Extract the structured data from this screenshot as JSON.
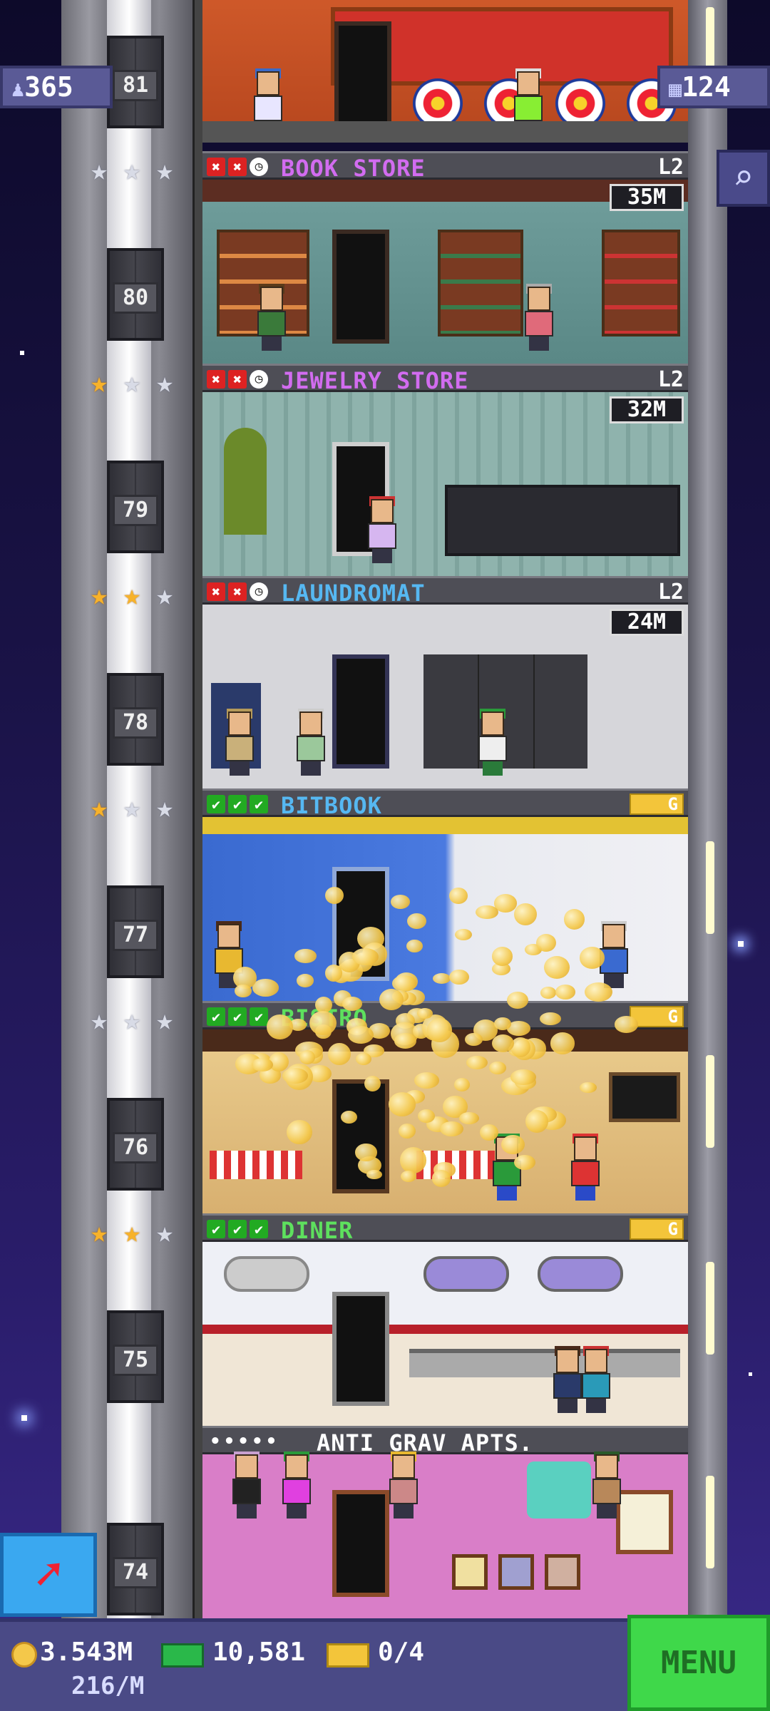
{
  "hud": {
    "population": "365",
    "floors": "124",
    "search_icon": "magnifier-icon"
  },
  "floors": [
    {
      "num": "81",
      "name": "",
      "type": "recreation",
      "level": "",
      "price": "",
      "status": []
    },
    {
      "num": "80",
      "name": "BOOK STORE",
      "color": "#d26cf0",
      "level": "L2",
      "price": "35M",
      "status": [
        "x",
        "x",
        "clock"
      ],
      "stars": 0
    },
    {
      "num": "79",
      "name": "JEWELRY STORE",
      "color": "#d26cf0",
      "level": "L2",
      "price": "32M",
      "status": [
        "x",
        "x",
        "clock"
      ],
      "stars": 1
    },
    {
      "num": "78",
      "name": "LAUNDROMAT",
      "color": "#56b8f2",
      "level": "L2",
      "price": "24M",
      "status": [
        "x",
        "x",
        "clock"
      ],
      "stars": 2
    },
    {
      "num": "77",
      "name": "BITBOOK",
      "color": "#56b8f2",
      "level": "G",
      "price": "",
      "status": [
        "c",
        "c",
        "c"
      ],
      "stars": 1
    },
    {
      "num": "76",
      "name": "BISTRO",
      "color": "#5ee05e",
      "level": "G",
      "price": "",
      "status": [
        "c",
        "c",
        "c"
      ],
      "stars": 0
    },
    {
      "num": "75",
      "name": "DINER",
      "color": "#5ee05e",
      "level": "G",
      "price": "",
      "status": [
        "c",
        "c",
        "c"
      ],
      "stars": 2
    },
    {
      "num": "74",
      "name": "ANTI GRAV APTS.",
      "color": "#ffffff",
      "level": "",
      "price": "",
      "residents": "•••••"
    }
  ],
  "bottom": {
    "coins": "3.543M",
    "coin_rate": "216/M",
    "bux": "10,581",
    "tickets": "0/4",
    "menu_label": "MENU"
  }
}
